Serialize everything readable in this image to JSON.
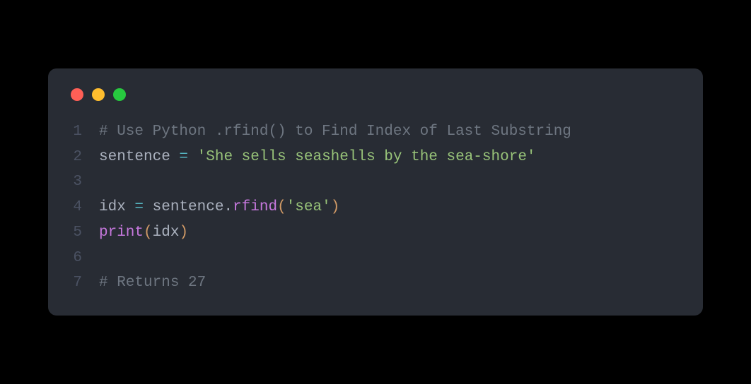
{
  "window": {
    "traffic_lights": [
      "red",
      "yellow",
      "green"
    ]
  },
  "code": {
    "lines": [
      {
        "num": "1",
        "tokens": [
          {
            "cls": "tok-comment",
            "text": "# Use Python .rfind() to Find Index of Last Substring"
          }
        ]
      },
      {
        "num": "2",
        "tokens": [
          {
            "cls": "tok-default",
            "text": "sentence "
          },
          {
            "cls": "tok-operator",
            "text": "="
          },
          {
            "cls": "tok-default",
            "text": " "
          },
          {
            "cls": "tok-string",
            "text": "'She sells seashells by the sea-shore'"
          }
        ]
      },
      {
        "num": "3",
        "tokens": []
      },
      {
        "num": "4",
        "tokens": [
          {
            "cls": "tok-default",
            "text": "idx "
          },
          {
            "cls": "tok-operator",
            "text": "="
          },
          {
            "cls": "tok-default",
            "text": " sentence."
          },
          {
            "cls": "tok-func",
            "text": "rfind"
          },
          {
            "cls": "tok-paren",
            "text": "("
          },
          {
            "cls": "tok-string",
            "text": "'sea'"
          },
          {
            "cls": "tok-paren",
            "text": ")"
          }
        ]
      },
      {
        "num": "5",
        "tokens": [
          {
            "cls": "tok-func",
            "text": "print"
          },
          {
            "cls": "tok-paren",
            "text": "("
          },
          {
            "cls": "tok-default",
            "text": "idx"
          },
          {
            "cls": "tok-paren",
            "text": ")"
          }
        ]
      },
      {
        "num": "6",
        "tokens": []
      },
      {
        "num": "7",
        "tokens": [
          {
            "cls": "tok-comment",
            "text": "# Returns 27"
          }
        ]
      }
    ]
  }
}
